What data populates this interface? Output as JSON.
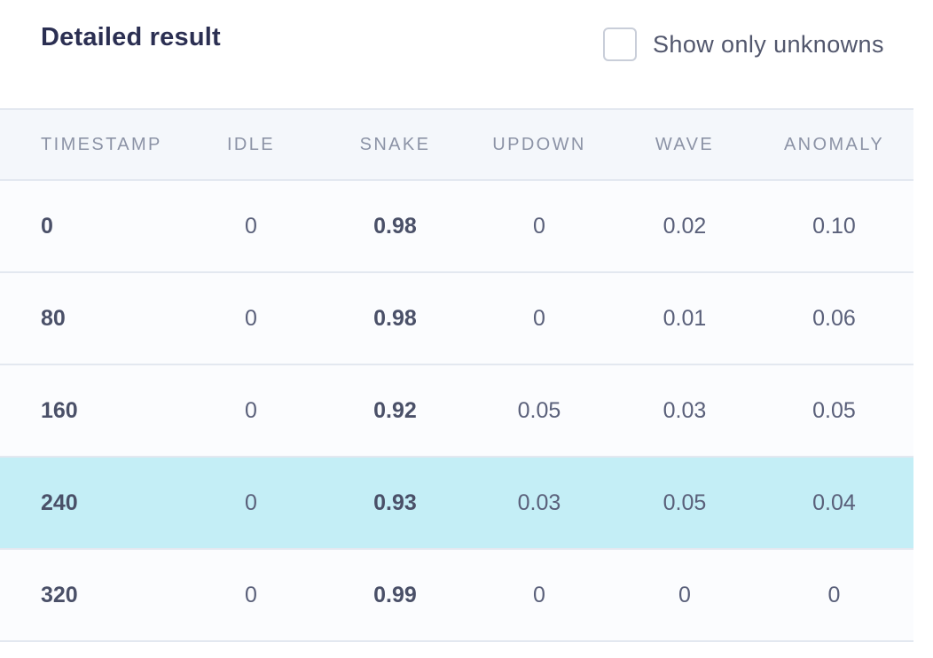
{
  "panel": {
    "title": "Detailed result",
    "filter_label": "Show only unknowns",
    "filter_checked": false
  },
  "table": {
    "columns": [
      "TIMESTAMP",
      "IDLE",
      "SNAKE",
      "UPDOWN",
      "WAVE",
      "ANOMALY"
    ],
    "rows": [
      [
        "0",
        "0",
        "0.98",
        "0",
        "0.02",
        "0.10"
      ],
      [
        "80",
        "0",
        "0.98",
        "0",
        "0.01",
        "0.06"
      ],
      [
        "160",
        "0",
        "0.92",
        "0.05",
        "0.03",
        "0.05"
      ],
      [
        "240",
        "0",
        "0.93",
        "0.03",
        "0.05",
        "0.04"
      ],
      [
        "320",
        "0",
        "0.99",
        "0",
        "0",
        "0"
      ]
    ],
    "highlighted_row": 3,
    "bold_column": 2
  },
  "colors": {
    "title": "#2b2f52",
    "header_bg": "#f4f7fb",
    "highlight_bg": "#c4eef6",
    "border": "#e3e8f0"
  }
}
